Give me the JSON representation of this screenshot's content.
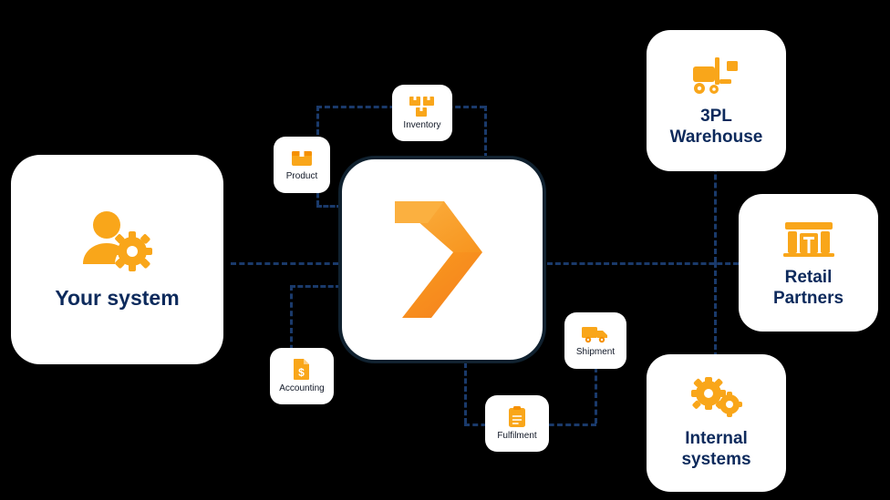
{
  "diagram": {
    "title": "Integration hub connectivity diagram",
    "background_color": "#000000",
    "line_color": "#1a3a6b",
    "accent_color": "#f9a61a",
    "label_color": "#0d2a5c",
    "left": {
      "label": "Your system",
      "icon": "user-gear-icon"
    },
    "hub": {
      "icon": "chevron-logo-icon"
    },
    "chips": [
      {
        "id": "inventory",
        "label": "Inventory",
        "icon": "boxes-icon"
      },
      {
        "id": "product",
        "label": "Product",
        "icon": "box-icon"
      },
      {
        "id": "accounting",
        "label": "Accounting",
        "icon": "invoice-dollar-icon"
      },
      {
        "id": "shipment",
        "label": "Shipment",
        "icon": "delivery-truck-icon"
      },
      {
        "id": "fulfilment",
        "label": "Fulfilment",
        "icon": "clipboard-check-icon"
      }
    ],
    "right": [
      {
        "id": "3pl",
        "label": "3PL\nWarehouse",
        "line1": "3PL",
        "line2": "Warehouse",
        "icon": "forklift-icon"
      },
      {
        "id": "retail",
        "label": "Retail Partners",
        "line1": "Retail",
        "line2": "Partners",
        "icon": "store-icon"
      },
      {
        "id": "internal",
        "label": "Internal systems",
        "line1": "Internal",
        "line2": "systems",
        "icon": "gears-icon"
      }
    ]
  }
}
